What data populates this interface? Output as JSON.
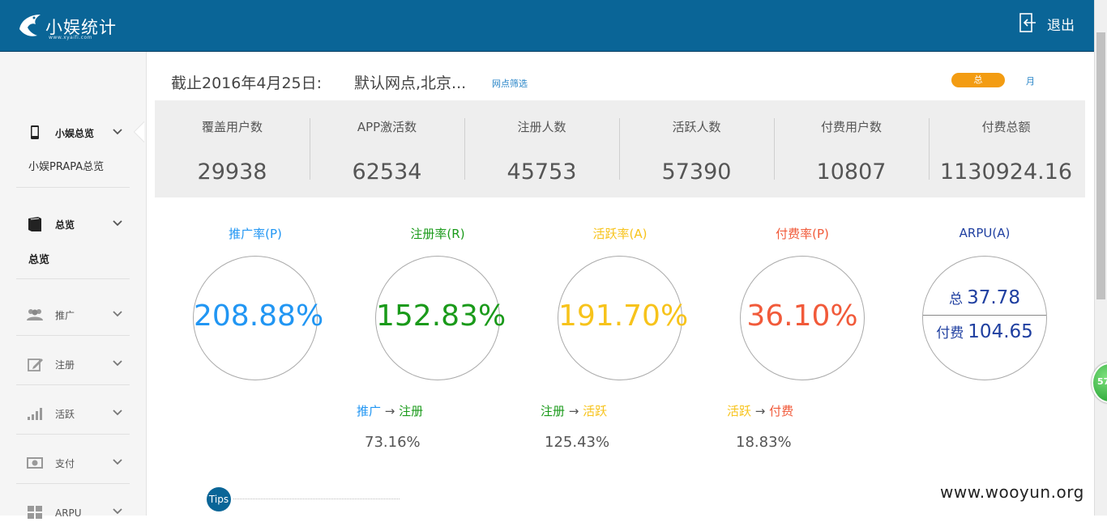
{
  "header": {
    "app_name": "小娱统计",
    "app_sub": "www.xyaifi.com",
    "logout_label": "退出"
  },
  "sidebar": {
    "groups": [
      {
        "label": "小娱总览",
        "sub": "小娱PRAPA总览",
        "icon": "phone-icon"
      },
      {
        "label": "总览",
        "sub": "总览",
        "icon": "book-icon"
      },
      {
        "label": "推广",
        "icon": "users-icon"
      },
      {
        "label": "注册",
        "icon": "edit-icon"
      },
      {
        "label": "活跃",
        "icon": "signal-bars-icon"
      },
      {
        "label": "支付",
        "icon": "money-icon"
      },
      {
        "label": "ARPU",
        "icon": "grid-icon"
      }
    ]
  },
  "main": {
    "title": "截止2016年4月25日:",
    "location": "默认网点,北京...",
    "filter_link": "网点筛选",
    "toggle_total": "总",
    "toggle_month": "月"
  },
  "stats": [
    {
      "label": "覆盖用户数",
      "value": "29938"
    },
    {
      "label": "APP激活数",
      "value": "62534"
    },
    {
      "label": "注册人数",
      "value": "45753"
    },
    {
      "label": "活跃人数",
      "value": "57390"
    },
    {
      "label": "付费用户数",
      "value": "10807"
    },
    {
      "label": "付费总额",
      "value": "1130924.16"
    }
  ],
  "metrics": [
    {
      "label": "推广率(P)",
      "value": "208.88%",
      "color": "#2196f3"
    },
    {
      "label": "注册率(R)",
      "value": "152.83%",
      "color": "#1a9a1a"
    },
    {
      "label": "活跃率(A)",
      "value": "191.70%",
      "color": "#f7c31b"
    },
    {
      "label": "付费率(P)",
      "value": "36.10%",
      "color": "#f15a3a"
    }
  ],
  "arpu": {
    "label": "ARPU(A)",
    "total_label": "总",
    "total_value": "37.78",
    "paid_label": "付费",
    "paid_value": "104.65",
    "color": "#1f3fa0"
  },
  "conversions": [
    {
      "from": "推广",
      "to": "注册",
      "value": "73.16%"
    },
    {
      "from": "注册",
      "to": "活跃",
      "value": "125.43%"
    },
    {
      "from": "活跃",
      "to": "付费",
      "value": "18.83%"
    }
  ],
  "conversion_arrow": "→",
  "tips_label": "Tips",
  "badge_value": "57",
  "watermark": "www.wooyun.org"
}
